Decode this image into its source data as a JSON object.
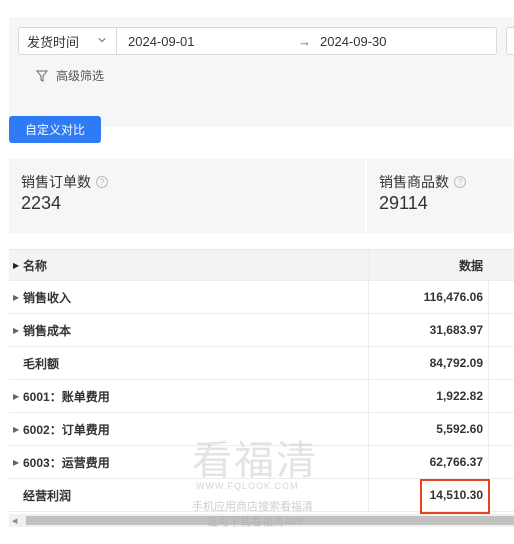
{
  "filters": {
    "date_type": "发货时间",
    "start_date": "2024-09-01",
    "end_date": "2024-09-30",
    "range_arrow": "→",
    "advanced_filter": "高级筛选"
  },
  "compare_button": "自定义对比",
  "stats": [
    {
      "label": "销售订单数",
      "value": "2234"
    },
    {
      "label": "销售商品数",
      "value": "29114"
    }
  ],
  "table": {
    "headers": {
      "name": "名称",
      "data": "数据"
    },
    "rows": [
      {
        "name": "销售收入",
        "value": "116,476.06",
        "expandable": true
      },
      {
        "name": "销售成本",
        "value": "31,683.97",
        "expandable": true
      },
      {
        "name": "毛利额",
        "value": "84,792.09",
        "expandable": false
      },
      {
        "name": "6001：账单费用",
        "value": "1,922.82",
        "expandable": true
      },
      {
        "name": "6002：订单费用",
        "value": "5,592.60",
        "expandable": true
      },
      {
        "name": "6003：运营费用",
        "value": "62,766.37",
        "expandable": true
      },
      {
        "name": "经营利润",
        "value": "14,510.30",
        "expandable": false
      }
    ]
  },
  "watermark": {
    "brand": "看福清",
    "url": "WWW.FQLOOK.COM",
    "line1": "手机应用商店搜索看福清",
    "line2": "这可下载看福清APP"
  },
  "colors": {
    "accent": "#2f7bf5",
    "highlight": "#e8431e"
  },
  "help_icon_glyph": "?"
}
